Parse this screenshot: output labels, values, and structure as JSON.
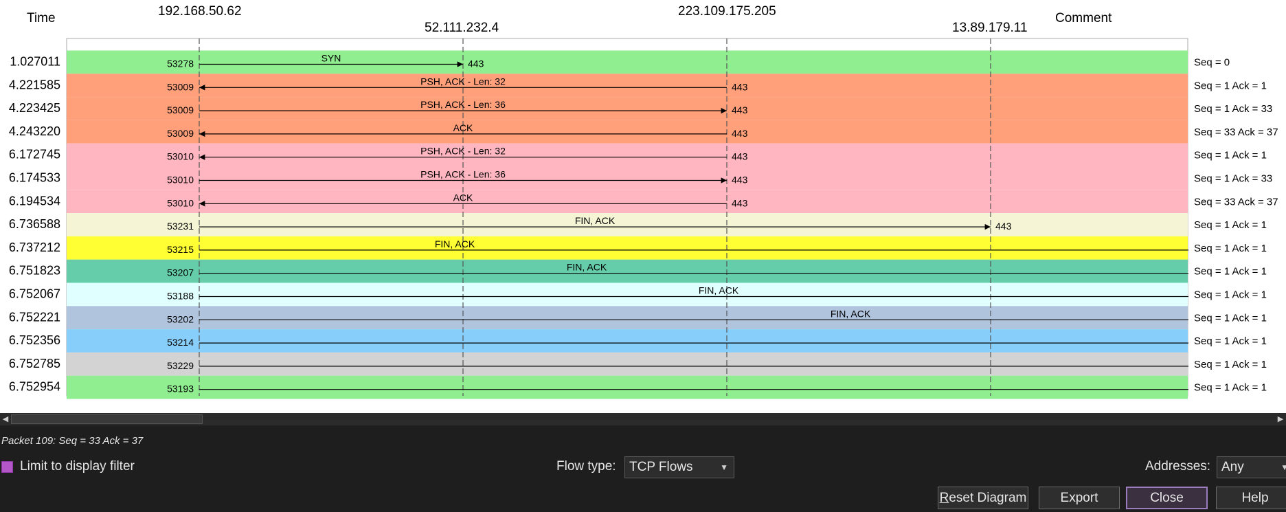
{
  "headers": {
    "time": "Time",
    "comment": "Comment",
    "hosts": [
      "192.168.50.62",
      "52.111.232.4",
      "223.109.175.205",
      "13.89.179.11"
    ]
  },
  "flows": [
    {
      "time": "1.027011",
      "port": "53278",
      "from": 0,
      "to": 1,
      "dport": "443",
      "label": "SYN",
      "comment": "Seq = 0",
      "color": "#90ee90"
    },
    {
      "time": "4.221585",
      "port": "53009",
      "from": 2,
      "to": 0,
      "dport": "443",
      "label": "PSH, ACK - Len: 32",
      "comment": "Seq = 1 Ack = 1",
      "color": "#ffa07a"
    },
    {
      "time": "4.223425",
      "port": "53009",
      "from": 0,
      "to": 2,
      "dport": "443",
      "label": "PSH, ACK - Len: 36",
      "comment": "Seq = 1 Ack = 33",
      "color": "#ffa07a"
    },
    {
      "time": "4.243220",
      "port": "53009",
      "from": 2,
      "to": 0,
      "dport": "443",
      "label": "ACK",
      "comment": "Seq = 33 Ack = 37",
      "color": "#ffa07a"
    },
    {
      "time": "6.172745",
      "port": "53010",
      "from": 2,
      "to": 0,
      "dport": "443",
      "label": "PSH, ACK - Len: 32",
      "comment": "Seq = 1 Ack = 1",
      "color": "#ffb6c1"
    },
    {
      "time": "6.174533",
      "port": "53010",
      "from": 0,
      "to": 2,
      "dport": "443",
      "label": "PSH, ACK - Len: 36",
      "comment": "Seq = 1 Ack = 33",
      "color": "#ffb6c1"
    },
    {
      "time": "6.194534",
      "port": "53010",
      "from": 2,
      "to": 0,
      "dport": "443",
      "label": "ACK",
      "comment": "Seq = 33 Ack = 37",
      "color": "#ffb6c1"
    },
    {
      "time": "6.736588",
      "port": "53231",
      "from": 0,
      "to": 3,
      "dport": "443",
      "label": "FIN, ACK",
      "comment": "Seq = 1 Ack = 1",
      "color": "#f5f5d5"
    },
    {
      "time": "6.737212",
      "port": "53215",
      "from": 0,
      "to": 5,
      "dport": "",
      "label": "FIN, ACK",
      "comment": "Seq = 1 Ack = 1",
      "color": "#ffff33"
    },
    {
      "time": "6.751823",
      "port": "53207",
      "from": 0,
      "to": 6,
      "dport": "",
      "label": "FIN, ACK",
      "comment": "Seq = 1 Ack = 1",
      "color": "#66cdaa"
    },
    {
      "time": "6.752067",
      "port": "53188",
      "from": 0,
      "to": 7,
      "dport": "",
      "label": "FIN, ACK",
      "comment": "Seq = 1 Ack = 1",
      "color": "#e0ffff"
    },
    {
      "time": "6.752221",
      "port": "53202",
      "from": 0,
      "to": 8,
      "dport": "",
      "label": "FIN, ACK",
      "comment": "Seq = 1 Ack = 1",
      "color": "#b0c4de"
    },
    {
      "time": "6.752356",
      "port": "53214",
      "from": 0,
      "to": 9,
      "dport": "",
      "label": "",
      "comment": "Seq = 1 Ack = 1",
      "color": "#87cefa"
    },
    {
      "time": "6.752785",
      "port": "53229",
      "from": 0,
      "to": 10,
      "dport": "",
      "label": "",
      "comment": "Seq = 1 Ack = 1",
      "color": "#d3d3d3"
    },
    {
      "time": "6.752954",
      "port": "53193",
      "from": 0,
      "to": 11,
      "dport": "",
      "label": "",
      "comment": "Seq = 1 Ack = 1",
      "color": "#90ee90"
    }
  ],
  "status": "Packet 109: Seq = 33 Ack = 37",
  "limit_filter_label": "Limit to display filter",
  "flow_type": {
    "label": "Flow type:",
    "value": "TCP Flows"
  },
  "addresses": {
    "label": "Addresses:",
    "value": "Any"
  },
  "buttons": {
    "reset_first": "R",
    "reset_rest": "eset Diagram",
    "export": "Export",
    "close": "Close",
    "help": "Help"
  }
}
